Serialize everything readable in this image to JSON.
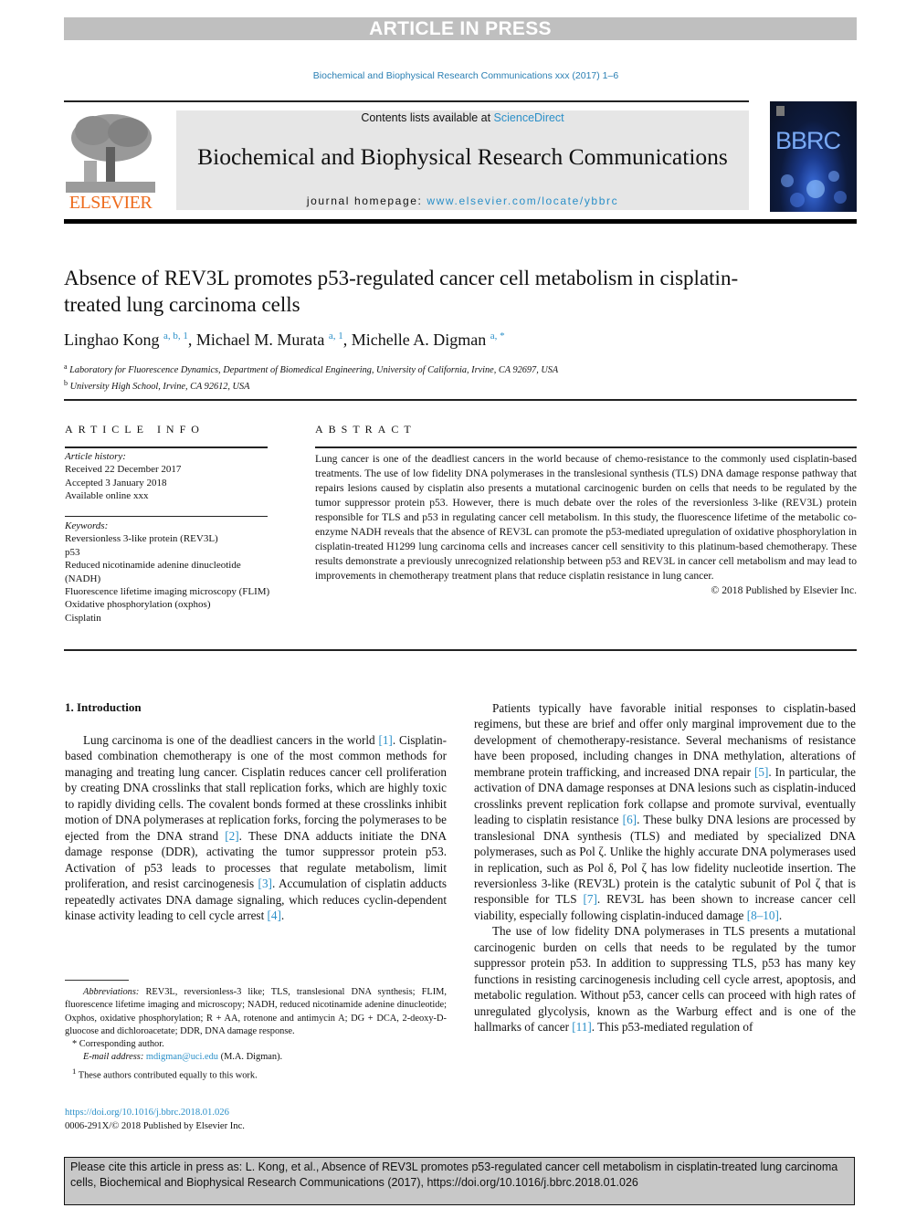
{
  "banner": {
    "text": "ARTICLE IN PRESS"
  },
  "journal_ref": "Biochemical and Biophysical Research Communications xxx (2017) 1–6",
  "publisher_logo": {
    "text": "ELSEVIER"
  },
  "masthead": {
    "contents_prefix": "Contents lists available at ",
    "contents_link": "ScienceDirect",
    "journal_title": "Biochemical and Biophysical Research Communications",
    "homepage_prefix": "journal homepage: ",
    "homepage_link": "www.elsevier.com/locate/ybbrc"
  },
  "cover": {
    "title": "BBRC"
  },
  "article": {
    "title": "Absence of REV3L promotes p53-regulated cancer cell metabolism in cisplatin-treated lung carcinoma cells",
    "authors": [
      {
        "name": "Linghao Kong",
        "sup": "a, b, 1"
      },
      {
        "name": "Michael M. Murata",
        "sup": "a, 1"
      },
      {
        "name": "Michelle A. Digman",
        "sup": "a, *"
      }
    ],
    "affiliations": [
      {
        "mark": "a",
        "text": "Laboratory for Fluorescence Dynamics, Department of Biomedical Engineering, University of California, Irvine, CA 92697, USA"
      },
      {
        "mark": "b",
        "text": "University High School, Irvine, CA 92612, USA"
      }
    ]
  },
  "article_info": {
    "heading": "ARTICLE INFO",
    "history_label": "Article history:",
    "history": [
      "Received 22 December 2017",
      "Accepted 3 January 2018",
      "Available online xxx"
    ],
    "keywords_label": "Keywords:",
    "keywords": [
      "Reversionless 3-like protein (REV3L)",
      "p53",
      "Reduced nicotinamide adenine dinucleotide (NADH)",
      "Fluorescence lifetime imaging microscopy (FLIM)",
      "Oxidative phosphorylation (oxphos)",
      "Cisplatin"
    ]
  },
  "abstract": {
    "heading": "ABSTRACT",
    "text": "Lung cancer is one of the deadliest cancers in the world because of chemo-resistance to the commonly used cisplatin-based treatments. The use of low fidelity DNA polymerases in the translesional synthesis (TLS) DNA damage response pathway that repairs lesions caused by cisplatin also presents a mutational carcinogenic burden on cells that needs to be regulated by the tumor suppressor protein p53. However, there is much debate over the roles of the reversionless 3-like (REV3L) protein responsible for TLS and p53 in regulating cancer cell metabolism. In this study, the fluorescence lifetime of the metabolic co-enzyme NADH reveals that the absence of REV3L can promote the p53-mediated upregulation of oxidative phosphorylation in cisplatin-treated H1299 lung carcinoma cells and increases cancer cell sensitivity to this platinum-based chemotherapy. These results demonstrate a previously unrecognized relationship between p53 and REV3L in cancer cell metabolism and may lead to improvements in chemotherapy treatment plans that reduce cisplatin resistance in lung cancer.",
    "copyright": "© 2018 Published by Elsevier Inc."
  },
  "introduction": {
    "heading": "1.  Introduction",
    "left_paragraph": [
      {
        "t": "Lung carcinoma is one of the deadliest cancers in the world "
      },
      {
        "r": "[1]"
      },
      {
        "t": ". Cisplatin-based combination chemotherapy is one of the most common methods for managing and treating lung cancer. Cisplatin reduces cancer cell proliferation by creating DNA crosslinks that stall replication forks, which are highly toxic to rapidly dividing cells. The covalent bonds formed at these crosslinks inhibit motion of DNA polymerases at replication forks, forcing the polymerases to be ejected from the DNA strand "
      },
      {
        "r": "[2]"
      },
      {
        "t": ". These DNA adducts initiate the DNA damage response (DDR), activating the tumor suppressor protein p53. Activation of p53 leads to processes that regulate metabolism, limit proliferation, and resist carcinogenesis "
      },
      {
        "r": "[3]"
      },
      {
        "t": ". Accumulation of cisplatin adducts repeatedly activates DNA damage signaling, which reduces cyclin-dependent kinase activity leading to cell cycle arrest "
      },
      {
        "r": "[4]"
      },
      {
        "t": "."
      }
    ],
    "right_paragraph_1": [
      {
        "t": "Patients typically have favorable initial responses to cisplatin-based regimens, but these are brief and offer only marginal improvement due to the development of chemotherapy-resistance. Several mechanisms of resistance have been proposed, including changes in DNA methylation, alterations of membrane protein trafficking, and increased DNA repair "
      },
      {
        "r": "[5]"
      },
      {
        "t": ". In particular, the activation of DNA damage responses at DNA lesions such as cisplatin-induced crosslinks prevent replication fork collapse and promote survival, eventually leading to cisplatin resistance "
      },
      {
        "r": "[6]"
      },
      {
        "t": ". These bulky DNA lesions are processed by translesional DNA synthesis (TLS) and mediated by specialized DNA polymerases, such as Pol ζ. Unlike the highly accurate DNA polymerases used in replication, such as Pol δ, Pol ζ has low fidelity nucleotide insertion. The reversionless 3-like (REV3L) protein is the catalytic subunit of Pol ζ that is responsible for TLS "
      },
      {
        "r": "[7]"
      },
      {
        "t": ". REV3L has been shown to increase cancer cell viability, especially following cisplatin-induced damage "
      },
      {
        "r": "[8–10]"
      },
      {
        "t": "."
      }
    ],
    "right_paragraph_2": [
      {
        "t": "The use of low fidelity DNA polymerases in TLS presents a mutational carcinogenic burden on cells that needs to be regulated by the tumor suppressor protein p53. In addition to suppressing TLS, p53 has many key functions in resisting carcinogenesis including cell cycle arrest, apoptosis, and metabolic regulation. Without p53, cancer cells can proceed with high rates of unregulated glycolysis, known as the Warburg effect and is one of the hallmarks of cancer "
      },
      {
        "r": "[11]"
      },
      {
        "t": ". This p53-mediated regulation of"
      }
    ]
  },
  "footnotes": {
    "abbreviations_label": "Abbreviations:",
    "abbreviations": " REV3L, reversionless-3 like; TLS, translesional DNA synthesis; FLIM, fluorescence lifetime imaging and microscopy; NADH, reduced nicotinamide adenine dinucleotide; Oxphos, oxidative phosphorylation; R + AA, rotenone and antimycin A; DG + DCA, 2-deoxy-D-gluocose and dichloroacetate; DDR, DNA damage response.",
    "corresponding": "* Corresponding author.",
    "email_label": "E-mail address:",
    "email": "mdigman@uci.edu",
    "email_suffix": " (M.A. Digman).",
    "equal_contrib": "These authors contributed equally to this work.",
    "equal_mark": "1"
  },
  "doi": {
    "link": "https://doi.org/10.1016/j.bbrc.2018.01.026",
    "issn": "0006-291X/© 2018 Published by Elsevier Inc."
  },
  "cite_box": {
    "text": "Please cite this article in press as: L. Kong, et al., Absence of REV3L promotes p53-regulated cancer cell metabolism in cisplatin-treated lung carcinoma cells, Biochemical and Biophysical Research Communications (2017), https://doi.org/10.1016/j.bbrc.2018.01.026"
  }
}
